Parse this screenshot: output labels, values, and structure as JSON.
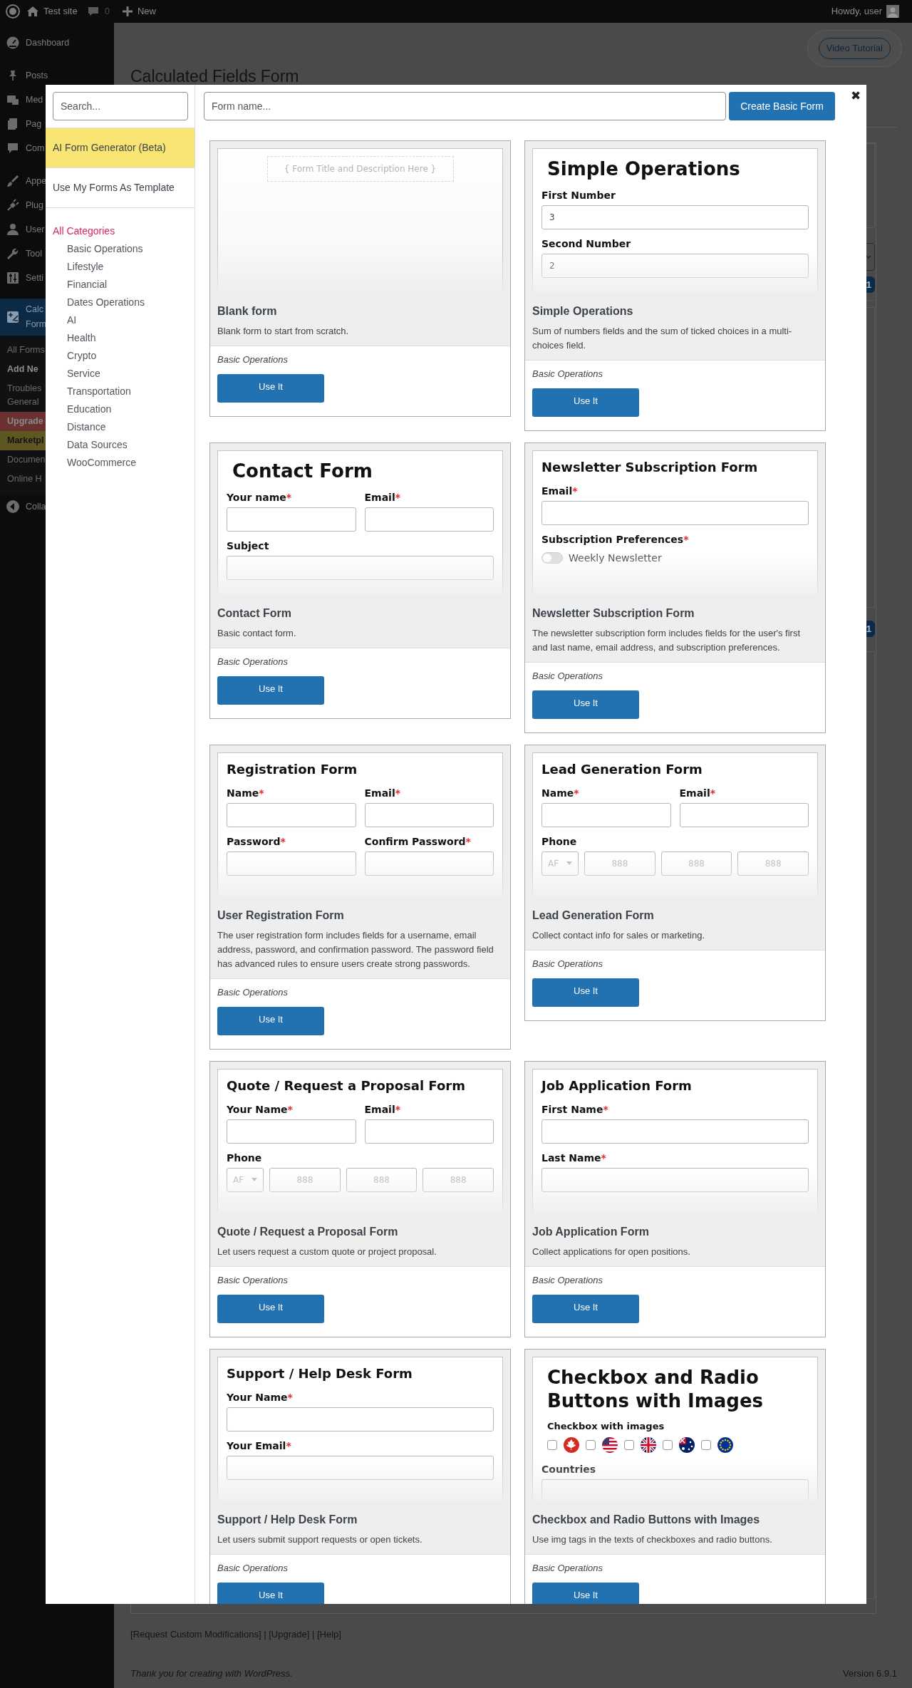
{
  "admin_bar": {
    "site": "Test site",
    "comments": "0",
    "new": "New",
    "greeting": "Howdy, user"
  },
  "admin_menu": {
    "groups": [
      [
        {
          "label": "Dashboard",
          "selected": false
        }
      ],
      [
        {
          "label": "Posts",
          "selected": false
        },
        {
          "label": "Med",
          "selected": false
        },
        {
          "label": "Pag",
          "selected": false
        },
        {
          "label": "Com",
          "selected": false
        }
      ],
      [
        {
          "label": "Appe",
          "selected": false
        },
        {
          "label": "Plug",
          "selected": false
        },
        {
          "label": "User",
          "selected": false
        },
        {
          "label": "Tool",
          "selected": false
        },
        {
          "label": "Setti",
          "selected": false
        }
      ],
      [
        {
          "label": "Calc Form",
          "selected": true,
          "submenu": [
            {
              "label": "All Forms",
              "selected": false
            },
            {
              "label": "Add Ne",
              "selected": true
            },
            {
              "label": "Troubles General",
              "selected": false
            },
            {
              "label": "Upgrade",
              "selected": false,
              "color": "#6b3131"
            },
            {
              "label": "Marketpl",
              "selected": false,
              "color": "#5e5722"
            },
            {
              "label": "Documen",
              "selected": false
            },
            {
              "label": "Online H",
              "selected": false
            }
          ]
        }
      ]
    ],
    "collapse": "Colla"
  },
  "page": {
    "video_button": "Video Tutorial",
    "heading": "Calculated Fields Form",
    "badges": [
      "1",
      "1"
    ],
    "footer_links": {
      "open": "[",
      "close": "]",
      "separator": " | ",
      "links": [
        "Request Custom Modifications",
        "Upgrade",
        "Help"
      ]
    },
    "footer": {
      "before": "Thank you for creating with ",
      "link": "WordPress",
      "after": "."
    },
    "version": "Version 6.9.1"
  },
  "modal": {
    "search": {
      "placeholder": "Search..."
    },
    "menu": [
      {
        "label": "AI Form Generator (Beta)",
        "color": "#f8e573"
      },
      {
        "label": "Use My Forms As Template",
        "color": "#ffffff"
      }
    ],
    "categories": [
      {
        "label": "All Categories",
        "selected": true,
        "children": [
          {
            "label": "Basic Operations",
            "selected": false
          },
          {
            "label": "Lifestyle",
            "selected": false
          },
          {
            "label": "Financial",
            "selected": false
          },
          {
            "label": "Dates Operations",
            "selected": false
          },
          {
            "label": "AI",
            "selected": false
          },
          {
            "label": "Health",
            "selected": false
          },
          {
            "label": "Crypto",
            "selected": false
          },
          {
            "label": "Service",
            "selected": false
          },
          {
            "label": "Transportation",
            "selected": false
          },
          {
            "label": "Education",
            "selected": false
          },
          {
            "label": "Distance",
            "selected": false
          },
          {
            "label": "Data Sources",
            "selected": false
          },
          {
            "label": "WooCommerce",
            "selected": false
          }
        ]
      }
    ],
    "form_name": {
      "placeholder": "Form name..."
    },
    "create_button": "Create Basic Form",
    "close": "✖",
    "templates": [
      {
        "title": "Blank form",
        "description": "Blank form to start from scratch.",
        "category": "Basic Operations",
        "button": "Use It",
        "preview": [
          {
            "kind": "placeholder",
            "text": "{ Form Title and Description Here }"
          }
        ]
      },
      {
        "title": "Simple Operations",
        "description": "Sum of numbers fields and the sum of ticked choices in a multi-choices field.",
        "category": "Basic Operations",
        "button": "Use It",
        "preview": [
          {
            "kind": "title",
            "text": "Simple Operations"
          },
          {
            "kind": "fields",
            "fields": [
              {
                "label": "First Number",
                "value": "3"
              }
            ]
          },
          {
            "kind": "fields",
            "fields": [
              {
                "label": "Second Number",
                "value": "2"
              }
            ]
          }
        ]
      },
      {
        "title": "Contact Form",
        "description": "Basic contact form.",
        "category": "Basic Operations",
        "button": "Use It",
        "preview": [
          {
            "kind": "title",
            "text": "Contact Form"
          },
          {
            "kind": "fields",
            "fields": [
              {
                "label": "Your name",
                "mark": "*"
              },
              {
                "label": "Email",
                "mark": "*"
              }
            ]
          },
          {
            "kind": "fields",
            "fields": [
              {
                "label": "Subject"
              }
            ]
          }
        ]
      },
      {
        "title": "Newsletter Subscription Form",
        "description": "The newsletter subscription form includes fields for the user's first and last name, email address, and subscription preferences.",
        "category": "Basic Operations",
        "button": "Use It",
        "preview": [
          {
            "kind": "heading",
            "text": "Newsletter Subscription Form"
          },
          {
            "kind": "fields",
            "fields": [
              {
                "label": "Email",
                "mark": "*"
              }
            ]
          },
          {
            "kind": "label",
            "text": "Subscription Preferences",
            "mark": "*"
          },
          {
            "kind": "toggle",
            "label": "Weekly Newsletter",
            "on": false
          }
        ]
      },
      {
        "title": "User Registration Form",
        "description": "The user registration form includes fields for a username, email address, password, and confirmation password. The password field has advanced rules to ensure users create strong passwords.",
        "category": "Basic Operations",
        "button": "Use It",
        "preview": [
          {
            "kind": "heading",
            "text": "Registration Form"
          },
          {
            "kind": "fields",
            "fields": [
              {
                "label": "Name",
                "mark": "*"
              },
              {
                "label": "Email",
                "mark": "*"
              }
            ]
          },
          {
            "kind": "fields",
            "fields": [
              {
                "label": "Password",
                "mark": "*"
              },
              {
                "label": "Confirm Password",
                "mark": "*"
              }
            ]
          }
        ]
      },
      {
        "title": "Lead Generation Form",
        "description": "Collect contact info for sales or marketing.",
        "category": "Basic Operations",
        "button": "Use It",
        "preview": [
          {
            "kind": "heading",
            "text": "Lead Generation Form"
          },
          {
            "kind": "fields",
            "fields": [
              {
                "label": "Name",
                "mark": "*"
              },
              {
                "label": "Email",
                "mark": "*"
              }
            ]
          },
          {
            "kind": "phone",
            "label": "Phone",
            "code": "AF",
            "parts": [
              "888",
              "888",
              "888"
            ]
          }
        ]
      },
      {
        "title": "Quote / Request a Proposal Form",
        "description": "Let users request a custom quote or project proposal.",
        "category": "Basic Operations",
        "button": "Use It",
        "preview": [
          {
            "kind": "heading",
            "text": "Quote / Request a Proposal Form"
          },
          {
            "kind": "fields",
            "fields": [
              {
                "label": "Your Name",
                "mark": "*"
              },
              {
                "label": "Email",
                "mark": "*"
              }
            ]
          },
          {
            "kind": "phone",
            "label": "Phone",
            "code": "AF",
            "parts": [
              "888",
              "888",
              "888"
            ]
          }
        ]
      },
      {
        "title": "Job Application Form",
        "description": "Collect applications for open positions.",
        "category": "Basic Operations",
        "button": "Use It",
        "preview": [
          {
            "kind": "heading",
            "text": "Job Application Form"
          },
          {
            "kind": "fields",
            "fields": [
              {
                "label": "First Name",
                "mark": "*"
              }
            ]
          },
          {
            "kind": "fields",
            "fields": [
              {
                "label": "Last Name",
                "mark": "*"
              }
            ]
          }
        ]
      },
      {
        "title": "Support / Help Desk Form",
        "description": "Let users submit support requests or open tickets.",
        "category": "Basic Operations",
        "button": "Use It",
        "preview": [
          {
            "kind": "heading",
            "text": "Support / Help Desk Form"
          },
          {
            "kind": "fields",
            "fields": [
              {
                "label": "Your Name",
                "mark": "*"
              }
            ]
          },
          {
            "kind": "fields",
            "fields": [
              {
                "label": "Your Email",
                "mark": "*"
              }
            ]
          }
        ]
      },
      {
        "title": "Checkbox and Radio Buttons with Images",
        "description": "Use img tags in the texts of checkboxes and radio buttons.",
        "category": "Basic Operations",
        "button": "Use It",
        "preview": [
          {
            "kind": "title",
            "text": "Checkbox and Radio Buttons with Images"
          },
          {
            "kind": "image-checkboxes",
            "label": "Checkbox with images",
            "options": [
              {
                "checked": false
              },
              {
                "checked": false
              },
              {
                "checked": false
              },
              {
                "checked": false
              },
              {
                "checked": false
              }
            ]
          },
          {
            "kind": "fields",
            "fields": [
              {
                "label": "Countries"
              }
            ]
          }
        ]
      }
    ]
  }
}
